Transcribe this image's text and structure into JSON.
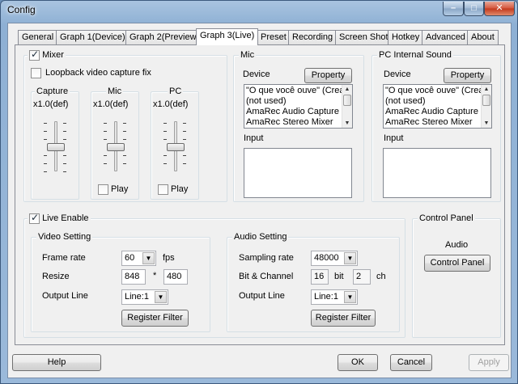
{
  "window": {
    "title": "Config",
    "minimize": "–",
    "maximize": "□",
    "close": "✕"
  },
  "tabs": [
    {
      "label": "General"
    },
    {
      "label": "Graph 1(Device)"
    },
    {
      "label": "Graph 2(Preview)"
    },
    {
      "label": "Graph 3(Live)",
      "active": true
    },
    {
      "label": "Preset"
    },
    {
      "label": "Recording"
    },
    {
      "label": "Screen Shot"
    },
    {
      "label": "Hotkey"
    },
    {
      "label": "Advanced"
    },
    {
      "label": "About"
    }
  ],
  "mixer": {
    "label": "Mixer",
    "checked": true,
    "loopback_label": "Loopback video capture fix",
    "loopback_checked": false,
    "capture": {
      "title": "Capture",
      "value": "x1.0(def)"
    },
    "mic": {
      "title": "Mic",
      "value": "x1.0(def)",
      "play_label": "Play",
      "play_checked": false
    },
    "pc": {
      "title": "PC",
      "value": "x1.0(def)",
      "play_label": "Play",
      "play_checked": false
    }
  },
  "mic_group": {
    "title": "Mic",
    "device_label": "Device",
    "property_label": "Property",
    "devices": [
      "\"O que você ouve\" (Creat",
      "(not used)",
      "AmaRec Audio Capture",
      "AmaRec Stereo Mixer"
    ],
    "input_label": "Input"
  },
  "pc_group": {
    "title": "PC Internal Sound",
    "device_label": "Device",
    "property_label": "Property",
    "devices": [
      "\"O que você ouve\" (Creat",
      "(not used)",
      "AmaRec Audio Capture",
      "AmaRec Stereo Mixer"
    ],
    "input_label": "Input"
  },
  "live": {
    "enable_label": "Live Enable",
    "enable_checked": true,
    "video": {
      "title": "Video Setting",
      "frame_rate_label": "Frame rate",
      "frame_rate_value": "60",
      "fps_label": "fps",
      "resize_label": "Resize",
      "width_value": "848",
      "times": "*",
      "height_value": "480",
      "output_line_label": "Output Line",
      "output_line_value": "Line:1",
      "register_filter_label": "Register Filter"
    },
    "audio": {
      "title": "Audio Setting",
      "sampling_rate_label": "Sampling rate",
      "sampling_rate_value": "48000",
      "bit_channel_label": "Bit & Channel",
      "bit_value": "16",
      "bit_unit": "bit",
      "ch_value": "2",
      "ch_unit": "ch",
      "output_line_label": "Output Line",
      "output_line_value": "Line:1",
      "register_filter_label": "Register Filter"
    }
  },
  "control_panel": {
    "title": "Control Panel",
    "audio_label": "Audio",
    "button_label": "Control Panel"
  },
  "footer": {
    "help_label": "Help",
    "ok_label": "OK",
    "cancel_label": "Cancel",
    "apply_label": "Apply"
  }
}
